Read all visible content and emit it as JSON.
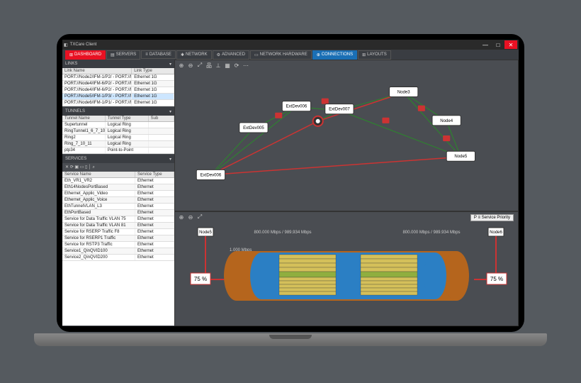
{
  "app_title": "TXCare Client",
  "menu": {
    "dashboard": "DASHBOARD",
    "servers": "SERVERS",
    "database": "DATABASE",
    "network": "NETWORK",
    "advanced": "ADVANCED",
    "hardware": "NETWORK HARDWARE",
    "connections": "CONNECTIONS",
    "layouts": "LAYOUTS"
  },
  "panels": {
    "links": "LINKS",
    "tunnels": "TUNNELS",
    "services": "SERVICES"
  },
  "links": {
    "cols": [
      "Link Name",
      "Link Type"
    ],
    "rows": [
      [
        "PORT://Node2/IFM-1/P2/ - PORT://Node...",
        "Ethernet 1G"
      ],
      [
        "PORT://Node4/IFM-6/P2/ - PORT://Node...",
        "Ethernet 1G"
      ],
      [
        "PORT://Node4/IFM-6/P2/ - PORT://Node...",
        "Ethernet 1G"
      ],
      [
        "PORT://Node5/IFM-1/P3/ - PORT://N...",
        "Ethernet 1G"
      ],
      [
        "PORT://Node6/IFM-1/P1/ - PORT://Nod...",
        "Ethernet 1G"
      ]
    ],
    "selected": 3
  },
  "tunnels": {
    "cols": [
      "Tunnel Name",
      "Tunnel Type",
      "Sub"
    ],
    "rows": [
      [
        "Supertunnel",
        "Logical Ring",
        ""
      ],
      [
        "RingTunnel1_6_7_10",
        "Logical Ring",
        ""
      ],
      [
        "Ring2",
        "Logical Ring",
        ""
      ],
      [
        "Ring_7_10_11",
        "Logical Ring",
        ""
      ],
      [
        "ptp34",
        "Point-to-Point",
        ""
      ]
    ]
  },
  "services": {
    "cols": [
      "Service Name",
      "Service Type"
    ],
    "rows": [
      [
        "Eth_VR1_VR2",
        "Ethernet"
      ],
      [
        "Eth14NodesPortBased",
        "Ethernet"
      ],
      [
        "Ethernet_Applic_Video",
        "Ethernet"
      ],
      [
        "Ethernet_Applic_Voice",
        "Ethernet"
      ],
      [
        "EthTunnelVLAN_L3",
        "Ethernet"
      ],
      [
        "EthPortBased",
        "Ethernet"
      ],
      [
        "Service for Data Traffic VLAN 75",
        "Ethernet"
      ],
      [
        "Service for Data Traffic VLAN 81",
        "Ethernet"
      ],
      [
        "Service for RSERP Traffic F8",
        "Ethernet"
      ],
      [
        "Service for RSERP1 Traffic",
        "Ethernet"
      ],
      [
        "Service for RSTP3 Traffic",
        "Ethernet"
      ],
      [
        "Service1_QinQVID100",
        "Ethernet"
      ],
      [
        "Service2_QinQVID200",
        "Ethernet"
      ]
    ]
  },
  "topology": {
    "nodes": [
      "Node3",
      "Node4",
      "Node5",
      "Node6",
      "ExtDev005",
      "ExtDev006",
      "ExtDev007"
    ]
  },
  "util": {
    "left_label": "800.000 Mbps / 989.934 Mbps",
    "right_label": "800.000 Mbps / 989.934 Mbps",
    "side_label": "1.000 Mbps",
    "pct_left": "75 %",
    "pct_right": "75 %",
    "priority_btn": "P ≡ Service Priority",
    "end_left": "Node5",
    "end_right": "Node6"
  }
}
